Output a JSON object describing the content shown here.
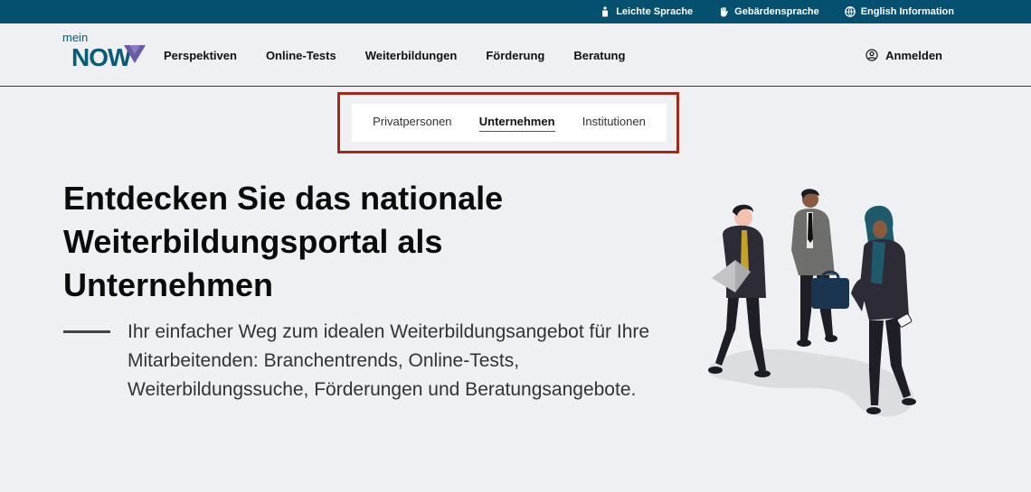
{
  "topbar": {
    "links": [
      {
        "label": "Leichte Sprache",
        "icon": "easy-language-icon"
      },
      {
        "label": "Gebärdensprache",
        "icon": "sign-language-icon"
      },
      {
        "label": "English Information",
        "icon": "globe-icon"
      }
    ]
  },
  "header": {
    "logo": {
      "small": "mein",
      "big": "NOW"
    },
    "nav": [
      "Perspektiven",
      "Online-Tests",
      "Weiterbildungen",
      "Förderung",
      "Beratung"
    ],
    "login_label": "Anmelden"
  },
  "tabs": {
    "items": [
      "Privatpersonen",
      "Unternehmen",
      "Institutionen"
    ],
    "active": "Unternehmen"
  },
  "hero": {
    "title_lines": [
      "Entdecken Sie das nationale",
      "Weiterbildungsportal als",
      "Unternehmen"
    ],
    "text": "Ihr einfacher Weg zum idealen Weiterbildungsangebot für Ihre Mitarbeitenden: Branchentrends, Online-Tests, Weiterbildungssuche, Förderungen und Beratungsangebote."
  },
  "colors": {
    "topbar": "#05506f",
    "brand": "#0b5a78",
    "accent": "#6b5aa6",
    "highlight_frame": "#a52a16"
  }
}
